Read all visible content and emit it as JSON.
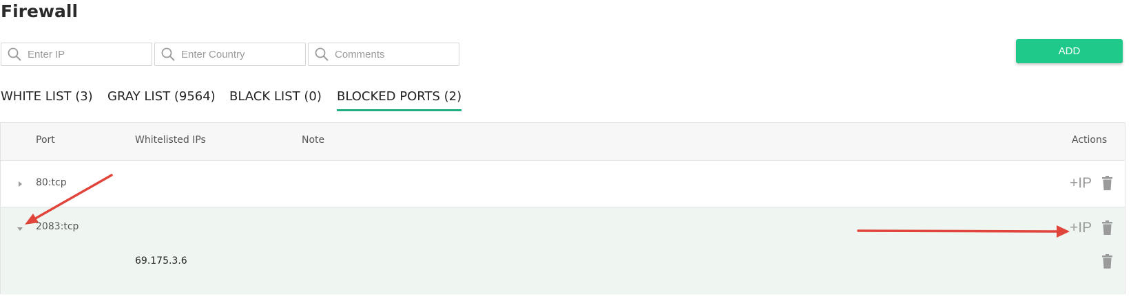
{
  "page": {
    "title": "Firewall"
  },
  "filters": {
    "ip_placeholder": "Enter IP",
    "country_placeholder": "Enter Country",
    "comments_placeholder": "Comments"
  },
  "toolbar": {
    "add_label": "ADD"
  },
  "tabs": [
    {
      "label": "WHITE LIST (3)",
      "active": false
    },
    {
      "label": "GRAY LIST (9564)",
      "active": false
    },
    {
      "label": "BLACK LIST (0)",
      "active": false
    },
    {
      "label": "BLOCKED PORTS (2)",
      "active": true
    }
  ],
  "table": {
    "columns": {
      "port": "Port",
      "whitelisted_ips": "Whitelisted IPs",
      "note": "Note",
      "actions": "Actions"
    },
    "rows": [
      {
        "port": "80:tcp",
        "expanded": false,
        "add_ip_label": "+IP",
        "whitelisted_ips": []
      },
      {
        "port": "2083:tcp",
        "expanded": true,
        "add_ip_label": "+IP",
        "whitelisted_ips": [
          "69.175.3.6"
        ]
      }
    ]
  },
  "colors": {
    "accent": "#1fc98a",
    "tab_underline": "#1fae82",
    "expanded_row_bg": "#eff6f1",
    "annotation_arrow": "#e0443a"
  },
  "icons": {
    "search": "search-icon",
    "trash": "trash-icon",
    "expand": "caret-right-icon",
    "collapse": "caret-down-icon"
  }
}
